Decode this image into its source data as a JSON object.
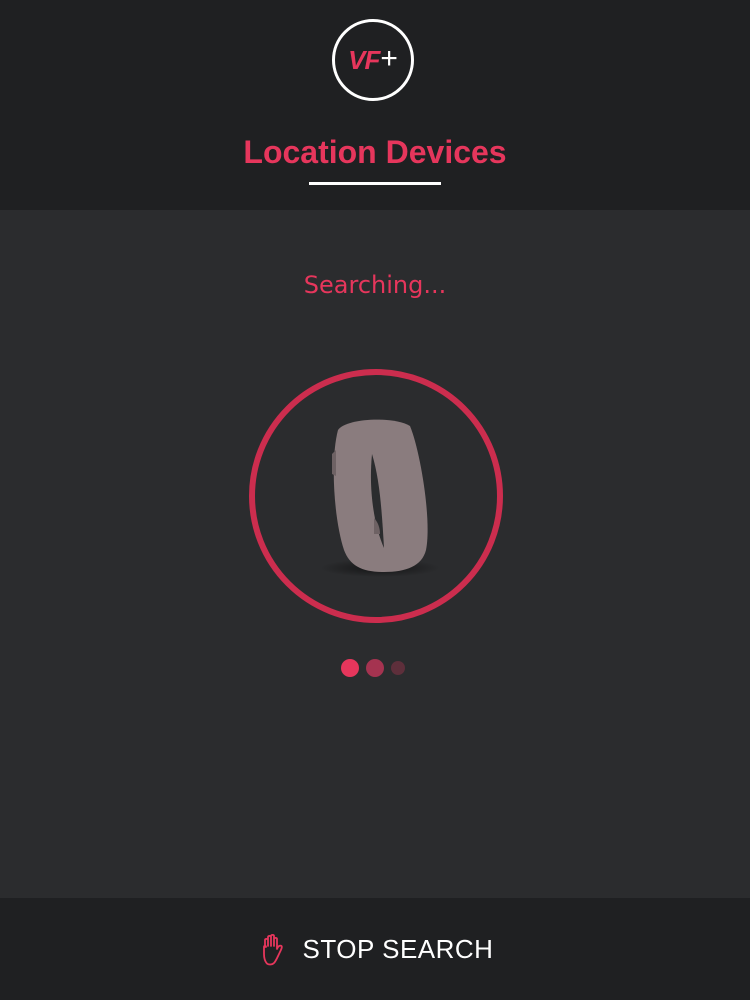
{
  "header": {
    "logo_text": "VF",
    "logo_plus": "+",
    "title": "Location Devices"
  },
  "main": {
    "status": "Searching...",
    "device_icon": "fitness-band-icon",
    "progress_dots": 3
  },
  "footer": {
    "button_icon": "hand-stop-icon",
    "button_label": "STOP SEARCH"
  },
  "colors": {
    "accent": "#e6365c",
    "ring": "#cc2d4e",
    "header_bg": "#1f2022",
    "body_bg": "#2b2c2e",
    "text_light": "#ffffff"
  }
}
